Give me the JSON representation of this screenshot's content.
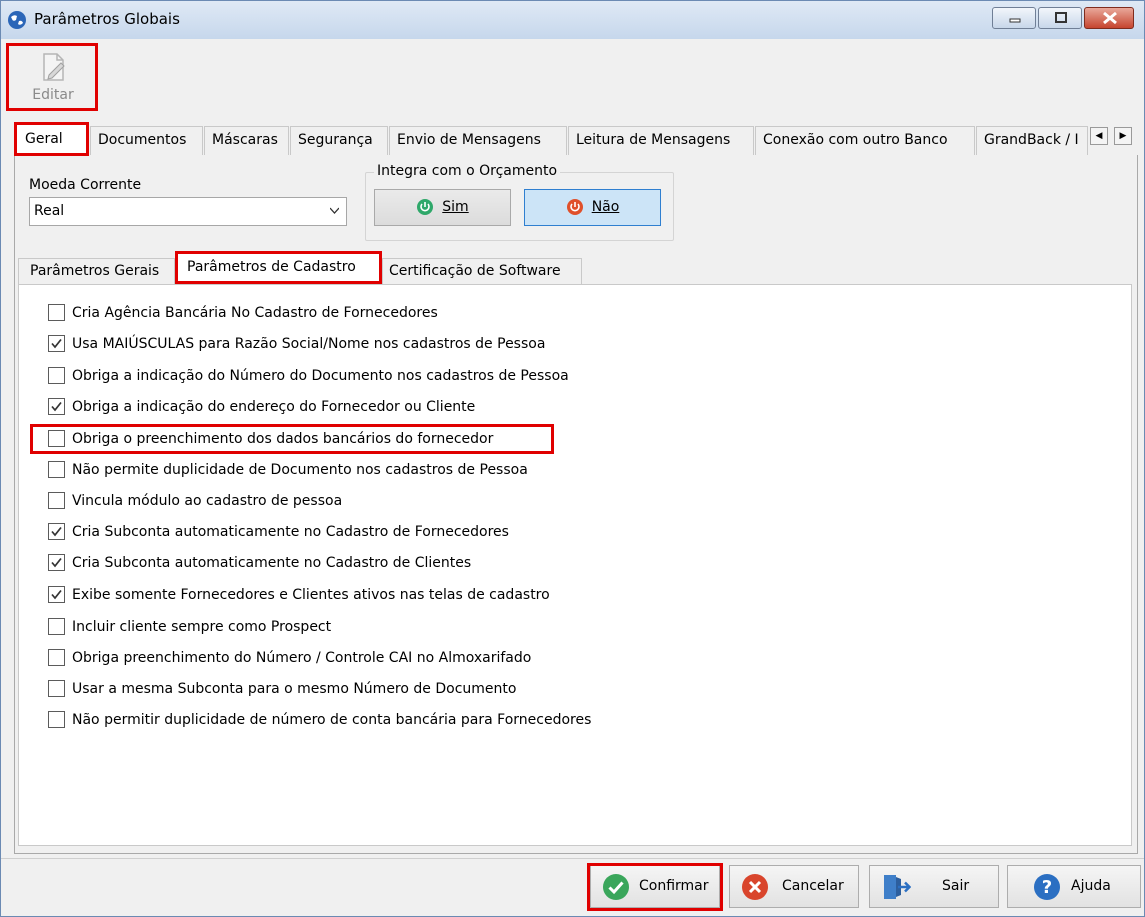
{
  "window": {
    "title": "Parâmetros Globais"
  },
  "toolbar": {
    "edit_label": "Editar"
  },
  "tabs": [
    "Geral",
    "Documentos",
    "Máscaras",
    "Segurança",
    "Envio de Mensagens",
    "Leitura de Mensagens",
    "Conexão com outro Banco",
    "GrandBack / I"
  ],
  "currency": {
    "label": "Moeda Corrente",
    "value": "Real"
  },
  "budget": {
    "title": "Integra com o Orçamento",
    "yes": "Sim",
    "no": "Não",
    "selected": "Não"
  },
  "subtabs": [
    "Parâmetros Gerais",
    "Parâmetros de Cadastro",
    "Certificação de Software"
  ],
  "options": [
    {
      "label": "Cria Agência Bancária No Cadastro de Fornecedores",
      "checked": false
    },
    {
      "label": "Usa MAIÚSCULAS para Razão Social/Nome nos cadastros de Pessoa",
      "checked": true
    },
    {
      "label": "Obriga a indicação do Número do Documento nos cadastros de Pessoa",
      "checked": false
    },
    {
      "label": "Obriga a indicação do endereço do Fornecedor ou Cliente",
      "checked": true
    },
    {
      "label": "Obriga o preenchimento dos dados bancários do fornecedor",
      "checked": false
    },
    {
      "label": "Não permite duplicidade de Documento nos cadastros de Pessoa",
      "checked": false
    },
    {
      "label": "Vincula módulo ao cadastro de pessoa",
      "checked": false
    },
    {
      "label": "Cria Subconta automaticamente no Cadastro de Fornecedores",
      "checked": true
    },
    {
      "label": "Cria Subconta automaticamente no Cadastro de Clientes",
      "checked": true
    },
    {
      "label": "Exibe somente Fornecedores e Clientes ativos nas telas de cadastro",
      "checked": true
    },
    {
      "label": "Incluir cliente sempre como Prospect",
      "checked": false
    },
    {
      "label": "Obriga preenchimento do Número / Controle CAI no Almoxarifado",
      "checked": false
    },
    {
      "label": "Usar a mesma Subconta para o mesmo Número de Documento",
      "checked": false
    },
    {
      "label": "Não permitir duplicidade de número de conta bancária para Fornecedores",
      "checked": false
    }
  ],
  "footer": {
    "confirm": "Confirmar",
    "cancel": "Cancelar",
    "exit": "Sair",
    "help": "Ajuda"
  },
  "colors": {
    "highlight": "#e00000",
    "selected_toggle": "#cce4f7",
    "confirm_icon": "#3aa65b",
    "cancel_icon": "#d9452c",
    "help_icon": "#2b6fc2"
  }
}
